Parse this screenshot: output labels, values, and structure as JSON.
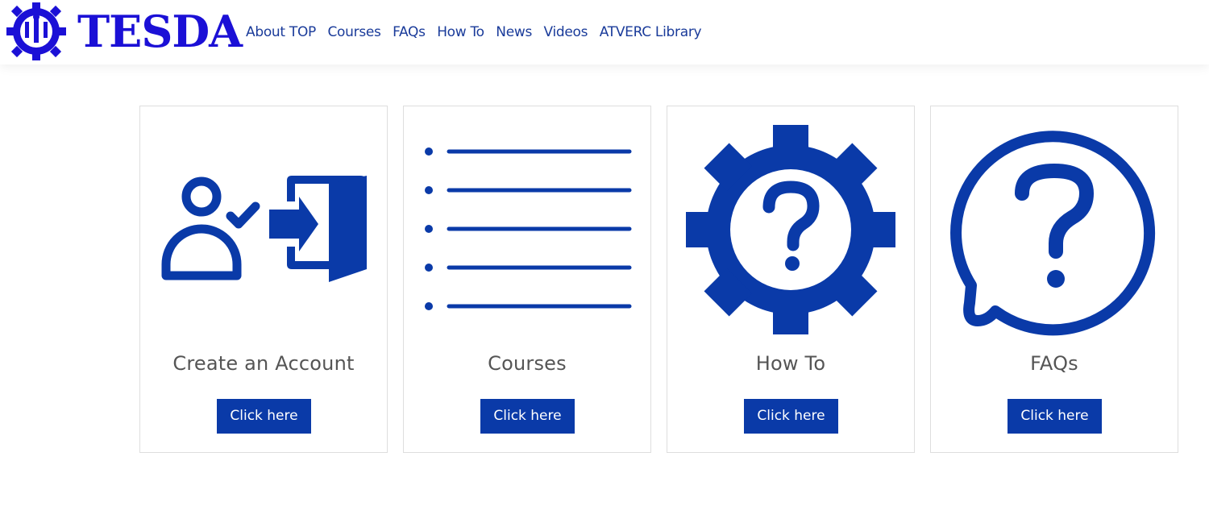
{
  "brand": {
    "name": "TESDA",
    "color": "#1b10d6",
    "icon": "tesda-gear-logo-icon"
  },
  "nav": {
    "items": [
      "About TOP",
      "Courses",
      "FAQs",
      "How To",
      "News",
      "Videos",
      "ATVERC Library"
    ],
    "color": "#1a3b9a"
  },
  "cards": [
    {
      "title": "Create an Account",
      "button": "Click here",
      "icon": "user-login-icon"
    },
    {
      "title": "Courses",
      "button": "Click here",
      "icon": "list-icon"
    },
    {
      "title": "How To",
      "button": "Click here",
      "icon": "gear-question-icon"
    },
    {
      "title": "FAQs",
      "button": "Click here",
      "icon": "speech-bubble-question-icon"
    }
  ],
  "theme": {
    "accent": "#0a3aa8",
    "card_border": "#dedede",
    "title_color": "#555555"
  }
}
